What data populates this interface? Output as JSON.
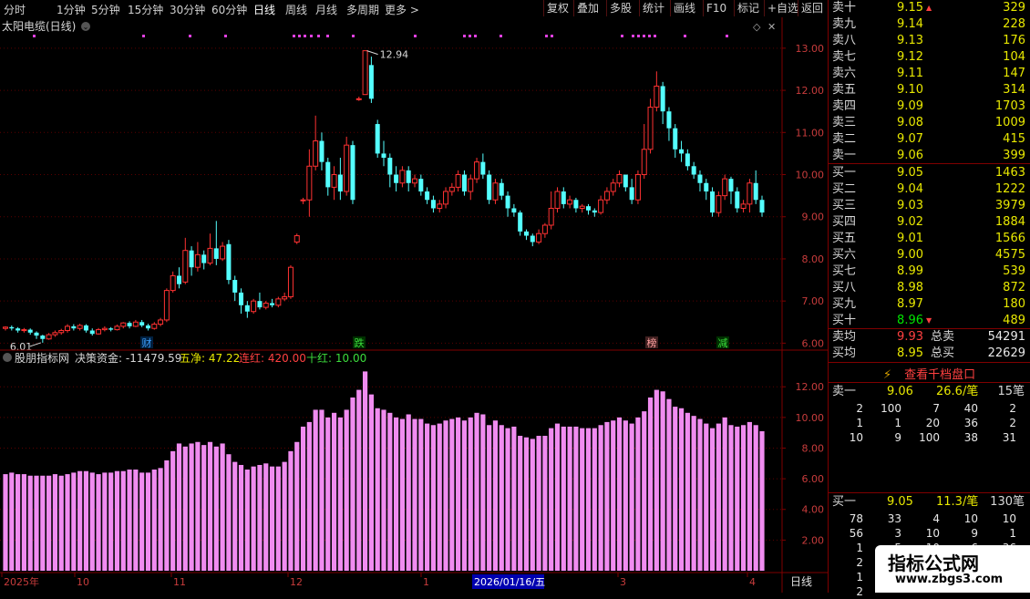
{
  "toolbar": {
    "periods": [
      "分时",
      "1分钟",
      "5分钟",
      "15分钟",
      "30分钟",
      "60分钟",
      "日线",
      "周线",
      "月线",
      "多周期",
      "更多 >"
    ],
    "active_period": "日线",
    "buttons": [
      "复权",
      "叠加",
      "多股",
      "统计",
      "画线",
      "F10",
      "标记",
      "+自选",
      "返回"
    ]
  },
  "main_chart": {
    "title": "太阳电缆(日线)",
    "y_ticks": [
      "13.00",
      "12.00",
      "11.00",
      "10.00",
      "9.00",
      "8.00",
      "7.00",
      "6.00"
    ],
    "high_label": "12.94",
    "low_label": "6.01",
    "markers": [
      {
        "text": "财",
        "color": "#3da0ff"
      },
      {
        "text": "跌",
        "color": "#3cdc3c"
      },
      {
        "text": "榜",
        "color": "#ffa0a0"
      },
      {
        "text": "减",
        "color": "#3cdc3c"
      }
    ]
  },
  "indicator": {
    "name": "股朋指标网",
    "label1": "决策资金: -11479.59",
    "label2": "五净: 47.22",
    "label3": "连红: 420.00",
    "label4": "十红: 10.00",
    "y_ticks": [
      "12.00",
      "10.00",
      "8.00",
      "6.00",
      "4.00",
      "2.00"
    ]
  },
  "time_axis": {
    "labels": [
      "2025年",
      "10",
      "11",
      "12",
      "1",
      "2026/01/16/五",
      "3",
      "4"
    ],
    "period_label": "日线"
  },
  "orderbook": {
    "asks": [
      {
        "label": "卖十",
        "price": "9.15",
        "vol": "329"
      },
      {
        "label": "卖九",
        "price": "9.14",
        "vol": "228"
      },
      {
        "label": "卖八",
        "price": "9.13",
        "vol": "176"
      },
      {
        "label": "卖七",
        "price": "9.12",
        "vol": "104"
      },
      {
        "label": "卖六",
        "price": "9.11",
        "vol": "147"
      },
      {
        "label": "卖五",
        "price": "9.10",
        "vol": "314"
      },
      {
        "label": "卖四",
        "price": "9.09",
        "vol": "1703"
      },
      {
        "label": "卖三",
        "price": "9.08",
        "vol": "1009"
      },
      {
        "label": "卖二",
        "price": "9.07",
        "vol": "415"
      },
      {
        "label": "卖一",
        "price": "9.06",
        "vol": "399"
      }
    ],
    "bids": [
      {
        "label": "买一",
        "price": "9.05",
        "vol": "1463"
      },
      {
        "label": "买二",
        "price": "9.04",
        "vol": "1222"
      },
      {
        "label": "买三",
        "price": "9.03",
        "vol": "3979"
      },
      {
        "label": "买四",
        "price": "9.02",
        "vol": "1884"
      },
      {
        "label": "买五",
        "price": "9.01",
        "vol": "1566"
      },
      {
        "label": "买六",
        "price": "9.00",
        "vol": "4575"
      },
      {
        "label": "买七",
        "price": "8.99",
        "vol": "539"
      },
      {
        "label": "买八",
        "price": "8.98",
        "vol": "872"
      },
      {
        "label": "买九",
        "price": "8.97",
        "vol": "180"
      },
      {
        "label": "买十",
        "price": "8.96",
        "vol": "489"
      }
    ],
    "avg_sell_label": "卖均",
    "avg_sell_price": "9.93",
    "total_sell_label": "总卖",
    "total_sell": "54291",
    "avg_buy_label": "买均",
    "avg_buy_price": "8.95",
    "total_buy_label": "总买",
    "total_buy": "22629",
    "view_depth": "查看千档盘口",
    "ask1_label": "卖一",
    "ask1_price": "9.06",
    "ask1_avg": "26.6/笔",
    "ask1_count": "15笔",
    "ask1_queue": [
      [
        "2",
        "100",
        "7",
        "40",
        "2"
      ],
      [
        "1",
        "1",
        "20",
        "36",
        "2"
      ],
      [
        "10",
        "9",
        "100",
        "38",
        "31"
      ]
    ],
    "bid1_label": "买一",
    "bid1_price": "9.05",
    "bid1_avg": "11.3/笔",
    "bid1_count": "130笔",
    "bid1_queue": [
      [
        "78",
        "33",
        "4",
        "10",
        "10"
      ],
      [
        "56",
        "3",
        "10",
        "9",
        "1"
      ],
      [
        "1",
        "5",
        "10",
        "6",
        "36"
      ],
      [
        "2",
        "",
        "",
        "",
        ""
      ],
      [
        "1",
        "",
        "",
        "",
        ""
      ],
      [
        "2",
        "",
        "",
        "",
        ""
      ]
    ]
  },
  "watermark": {
    "title": "指标公式网",
    "url": "www.zbgs3.com"
  },
  "chart_data": {
    "type": "candlestick",
    "title": "太阳电缆(日线)",
    "ylim": [
      5.9,
      13.3
    ],
    "candles": [
      [
        6.35,
        6.38,
        6.3,
        6.4
      ],
      [
        6.38,
        6.35,
        6.3,
        6.42
      ],
      [
        6.35,
        6.3,
        6.25,
        6.38
      ],
      [
        6.3,
        6.32,
        6.25,
        6.36
      ],
      [
        6.32,
        6.25,
        6.2,
        6.35
      ],
      [
        6.25,
        6.18,
        6.1,
        6.28
      ],
      [
        6.18,
        6.1,
        6.01,
        6.2
      ],
      [
        6.1,
        6.2,
        6.08,
        6.24
      ],
      [
        6.2,
        6.25,
        6.15,
        6.3
      ],
      [
        6.25,
        6.3,
        6.2,
        6.34
      ],
      [
        6.3,
        6.4,
        6.25,
        6.45
      ],
      [
        6.4,
        6.35,
        6.3,
        6.45
      ],
      [
        6.35,
        6.42,
        6.3,
        6.46
      ],
      [
        6.42,
        6.3,
        6.25,
        6.45
      ],
      [
        6.3,
        6.22,
        6.18,
        6.35
      ],
      [
        6.22,
        6.32,
        6.2,
        6.36
      ],
      [
        6.32,
        6.35,
        6.28,
        6.4
      ],
      [
        6.35,
        6.32,
        6.28,
        6.38
      ],
      [
        6.32,
        6.4,
        6.3,
        6.44
      ],
      [
        6.4,
        6.48,
        6.35,
        6.5
      ],
      [
        6.48,
        6.4,
        6.35,
        6.52
      ],
      [
        6.4,
        6.5,
        6.38,
        6.55
      ],
      [
        6.5,
        6.42,
        6.38,
        6.55
      ],
      [
        6.42,
        6.35,
        6.3,
        6.46
      ],
      [
        6.35,
        6.45,
        6.32,
        6.5
      ],
      [
        6.45,
        6.55,
        6.4,
        6.6
      ],
      [
        6.55,
        7.25,
        6.5,
        7.3
      ],
      [
        7.25,
        7.6,
        7.2,
        7.7
      ],
      [
        7.6,
        7.4,
        7.3,
        7.8
      ],
      [
        7.45,
        8.2,
        7.4,
        8.5
      ],
      [
        8.2,
        7.8,
        7.6,
        8.3
      ],
      [
        7.8,
        8.1,
        7.7,
        8.4
      ],
      [
        8.1,
        7.9,
        7.75,
        8.2
      ],
      [
        7.9,
        8.25,
        7.85,
        8.6
      ],
      [
        8.25,
        8.0,
        7.85,
        8.9
      ],
      [
        8.0,
        8.3,
        7.95,
        8.4
      ],
      [
        8.35,
        7.5,
        7.4,
        8.45
      ],
      [
        7.5,
        7.2,
        7.0,
        7.6
      ],
      [
        7.2,
        6.9,
        6.7,
        7.3
      ],
      [
        6.9,
        6.75,
        6.6,
        7.0
      ],
      [
        6.75,
        7.0,
        6.7,
        7.05
      ],
      [
        7.0,
        6.85,
        6.8,
        7.2
      ],
      [
        6.85,
        6.95,
        6.8,
        7.0
      ],
      [
        6.95,
        6.9,
        6.85,
        7.05
      ],
      [
        6.9,
        7.05,
        6.85,
        7.1
      ],
      [
        7.05,
        7.1,
        7.0,
        7.2
      ],
      [
        7.1,
        7.8,
        7.05,
        7.85
      ],
      [
        8.4,
        8.55,
        8.35,
        8.6
      ],
      [
        9.4,
        9.4,
        9.3,
        9.45
      ],
      [
        9.4,
        10.2,
        9.0,
        10.6
      ],
      [
        10.2,
        10.8,
        10.1,
        11.4
      ],
      [
        10.8,
        10.3,
        10.1,
        11.0
      ],
      [
        10.3,
        9.7,
        9.5,
        10.4
      ],
      [
        9.7,
        10.0,
        9.4,
        10.2
      ],
      [
        10.0,
        9.6,
        9.4,
        10.4
      ],
      [
        9.6,
        10.7,
        9.5,
        10.9
      ],
      [
        10.7,
        9.4,
        9.3,
        10.8
      ],
      [
        11.8,
        11.8,
        11.75,
        11.85
      ],
      [
        11.9,
        12.94,
        11.9,
        12.94
      ],
      [
        12.6,
        11.8,
        11.7,
        12.8
      ],
      [
        11.2,
        10.5,
        10.4,
        11.3
      ],
      [
        10.5,
        10.4,
        10.2,
        10.8
      ],
      [
        10.4,
        10.0,
        9.7,
        10.5
      ],
      [
        10.0,
        9.8,
        9.6,
        10.2
      ],
      [
        9.8,
        10.1,
        9.7,
        10.2
      ],
      [
        10.1,
        9.8,
        9.6,
        10.2
      ],
      [
        9.8,
        9.9,
        9.7,
        10.0
      ],
      [
        9.9,
        9.6,
        9.5,
        10.0
      ],
      [
        9.6,
        9.4,
        9.3,
        9.7
      ],
      [
        9.4,
        9.2,
        9.1,
        9.5
      ],
      [
        9.2,
        9.3,
        9.1,
        9.4
      ],
      [
        9.3,
        9.6,
        9.2,
        9.7
      ],
      [
        9.6,
        9.7,
        9.5,
        9.8
      ],
      [
        9.7,
        10.0,
        9.6,
        10.1
      ],
      [
        10.0,
        9.6,
        9.5,
        10.1
      ],
      [
        9.6,
        9.9,
        9.4,
        10.0
      ],
      [
        9.9,
        10.3,
        9.8,
        10.4
      ],
      [
        10.3,
        10.0,
        9.9,
        10.5
      ],
      [
        10.0,
        9.4,
        9.3,
        10.1
      ],
      [
        9.4,
        9.8,
        9.3,
        9.9
      ],
      [
        9.8,
        9.5,
        9.4,
        9.9
      ],
      [
        9.5,
        9.2,
        9.0,
        9.6
      ],
      [
        9.2,
        9.1,
        9.0,
        9.3
      ],
      [
        9.1,
        8.65,
        8.55,
        9.15
      ],
      [
        8.65,
        8.55,
        8.45,
        8.7
      ],
      [
        8.55,
        8.4,
        8.3,
        8.6
      ],
      [
        8.4,
        8.6,
        8.35,
        8.7
      ],
      [
        8.6,
        8.8,
        8.5,
        8.85
      ],
      [
        8.8,
        9.2,
        8.7,
        9.6
      ],
      [
        9.2,
        9.6,
        9.1,
        9.7
      ],
      [
        9.6,
        9.3,
        9.2,
        9.7
      ],
      [
        9.3,
        9.4,
        9.2,
        9.5
      ],
      [
        9.4,
        9.2,
        9.1,
        9.45
      ],
      [
        9.2,
        9.25,
        9.1,
        9.3
      ],
      [
        9.25,
        9.15,
        9.05,
        9.3
      ],
      [
        9.15,
        9.1,
        9.0,
        9.2
      ],
      [
        9.1,
        9.4,
        9.05,
        9.5
      ],
      [
        9.4,
        9.6,
        9.3,
        9.7
      ],
      [
        9.6,
        9.8,
        9.5,
        9.9
      ],
      [
        9.8,
        10.0,
        9.7,
        10.1
      ],
      [
        10.0,
        9.7,
        9.6,
        10.0
      ],
      [
        9.7,
        9.4,
        9.3,
        9.9
      ],
      [
        9.4,
        10.0,
        9.3,
        10.1
      ],
      [
        10.0,
        10.6,
        9.9,
        11.2
      ],
      [
        10.6,
        11.6,
        10.5,
        11.8
      ],
      [
        11.6,
        12.1,
        11.5,
        12.45
      ],
      [
        12.1,
        11.5,
        11.2,
        12.2
      ],
      [
        11.5,
        11.1,
        10.8,
        11.6
      ],
      [
        11.1,
        10.6,
        10.4,
        11.2
      ],
      [
        10.6,
        10.5,
        10.3,
        10.8
      ],
      [
        10.5,
        10.2,
        10.1,
        10.6
      ],
      [
        10.2,
        10.0,
        9.9,
        10.3
      ],
      [
        10.0,
        9.8,
        9.6,
        10.1
      ],
      [
        9.8,
        9.6,
        9.4,
        9.9
      ],
      [
        9.6,
        9.1,
        9.0,
        9.7
      ],
      [
        9.1,
        9.5,
        9.0,
        9.6
      ],
      [
        9.5,
        9.9,
        9.4,
        10.0
      ],
      [
        9.9,
        9.6,
        9.3,
        9.95
      ],
      [
        9.6,
        9.2,
        9.1,
        9.7
      ],
      [
        9.2,
        9.3,
        9.1,
        9.4
      ],
      [
        9.3,
        9.8,
        9.1,
        9.9
      ],
      [
        9.8,
        9.4,
        9.3,
        10.1
      ],
      [
        9.4,
        9.1,
        9.0,
        9.5
      ]
    ],
    "indicator_values": [
      6.3,
      6.4,
      6.3,
      6.3,
      6.2,
      6.2,
      6.2,
      6.2,
      6.3,
      6.2,
      6.3,
      6.4,
      6.5,
      6.5,
      6.4,
      6.3,
      6.4,
      6.4,
      6.5,
      6.5,
      6.6,
      6.6,
      6.4,
      6.4,
      6.6,
      6.7,
      7.2,
      7.8,
      8.3,
      8.1,
      8.3,
      8.4,
      8.2,
      8.4,
      8.1,
      8.3,
      7.6,
      7.1,
      6.9,
      6.6,
      6.8,
      6.9,
      7.0,
      6.8,
      6.8,
      7.1,
      7.8,
      8.4,
      9.4,
      9.7,
      10.5,
      10.5,
      10.0,
      10.3,
      10.0,
      10.5,
      11.3,
      11.8,
      13.0,
      11.5,
      10.6,
      10.5,
      10.3,
      10.0,
      9.9,
      10.2,
      9.9,
      9.9,
      9.6,
      9.5,
      9.6,
      9.8,
      9.9,
      10.0,
      9.8,
      10.0,
      10.3,
      10.2,
      9.5,
      9.8,
      9.5,
      9.3,
      9.4,
      8.8,
      8.7,
      8.6,
      8.8,
      8.8,
      9.3,
      9.6,
      9.4,
      9.4,
      9.4,
      9.3,
      9.3,
      9.3,
      9.5,
      9.7,
      9.8,
      10.0,
      9.8,
      9.6,
      10.0,
      10.4,
      11.3,
      11.8,
      11.7,
      11.2,
      10.7,
      10.6,
      10.3,
      10.1,
      9.9,
      9.6,
      9.3,
      9.6,
      10.0,
      9.5,
      9.4,
      9.5,
      9.7,
      9.5,
      9.1
    ],
    "indicator_ylim": [
      0,
      13.5
    ]
  }
}
